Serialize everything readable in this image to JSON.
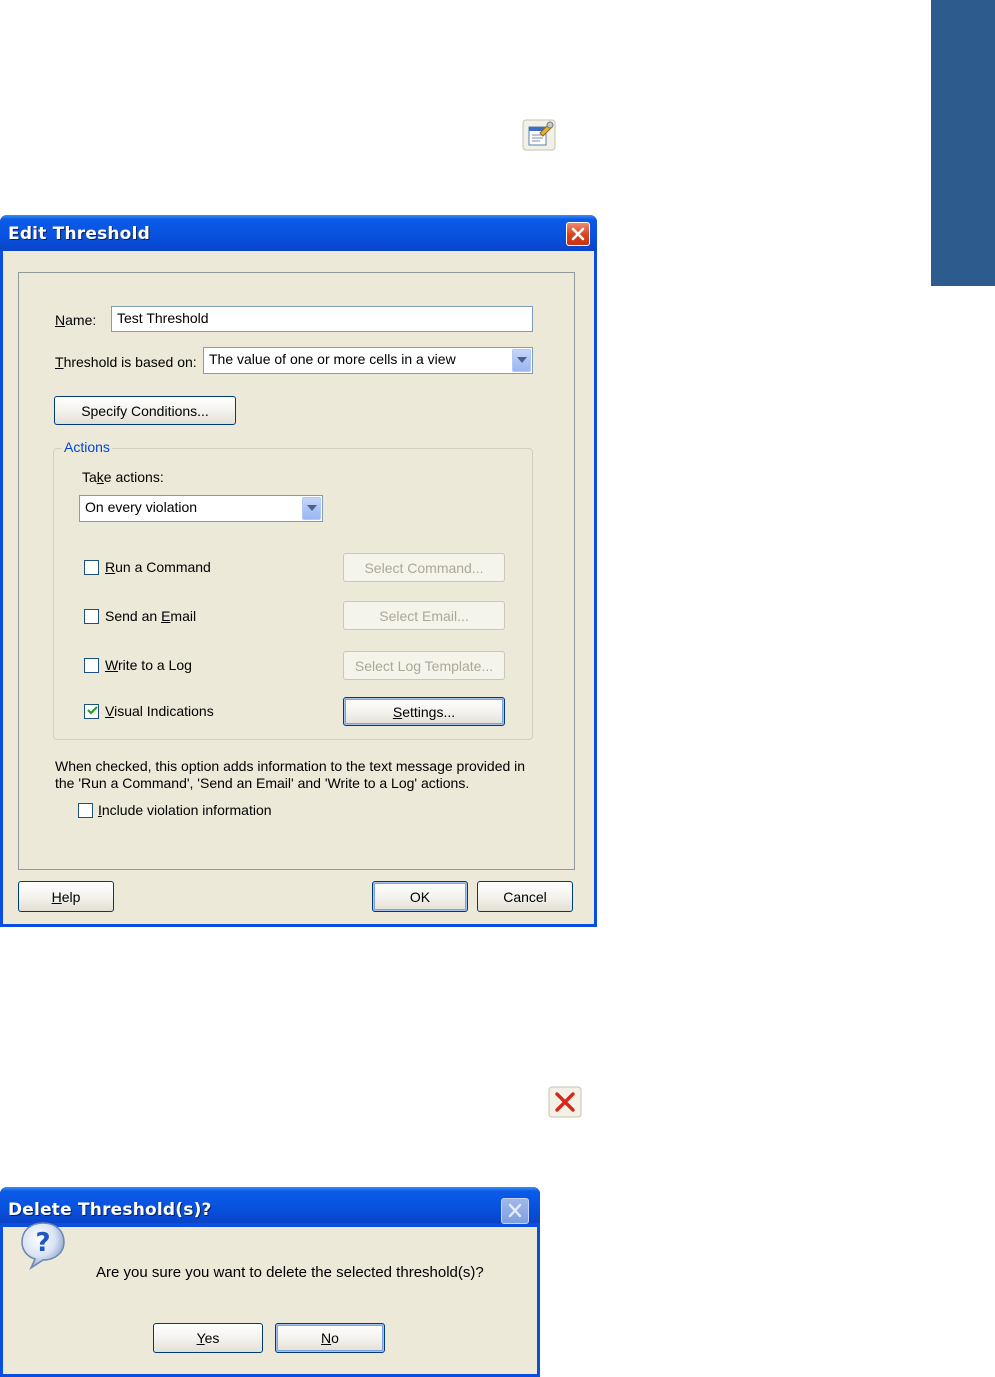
{
  "colors": {
    "title_bar": "#0a54e0",
    "dialog_face": "#ece9d8",
    "side_tab": "#2d5b8e",
    "close_red": "#d8411a",
    "group_label_blue": "#0046d5"
  },
  "icons": {
    "properties": "properties-icon",
    "delete": "delete-x-icon",
    "question": "question-icon"
  },
  "edit_dialog": {
    "title": "Edit Threshold",
    "name_label": "Name:",
    "name_value": "Test Threshold",
    "based_on_label": "Threshold is based on:",
    "based_on_value": "The value of one or more cells in a view",
    "specify_conditions": "Specify Conditions...",
    "actions_group": {
      "legend": "Actions",
      "take_actions_label": "Take actions:",
      "take_actions_value": "On every violation",
      "rows": [
        {
          "label": "Run a Command",
          "checked": false,
          "button": "Select Command...",
          "button_enabled": false
        },
        {
          "label": "Send an Email",
          "checked": false,
          "button": "Select Email...",
          "button_enabled": false
        },
        {
          "label": "Write to a Log",
          "checked": false,
          "button": "Select Log Template...",
          "button_enabled": false
        },
        {
          "label": "Visual Indications",
          "checked": true,
          "button": "Settings...",
          "button_enabled": true
        }
      ]
    },
    "info_text_line1": "When checked, this option adds information to the text message provided in",
    "info_text_line2": "the 'Run a Command', 'Send an Email' and 'Write to a Log' actions.",
    "include_violation_label": "Include violation information",
    "include_violation_checked": false,
    "help_button": "Help",
    "ok_button": "OK",
    "cancel_button": "Cancel"
  },
  "delete_dialog": {
    "title": "Delete Threshold(s)?",
    "message": "Are you sure you want to delete the selected threshold(s)?",
    "yes_button": "Yes",
    "no_button": "No"
  }
}
